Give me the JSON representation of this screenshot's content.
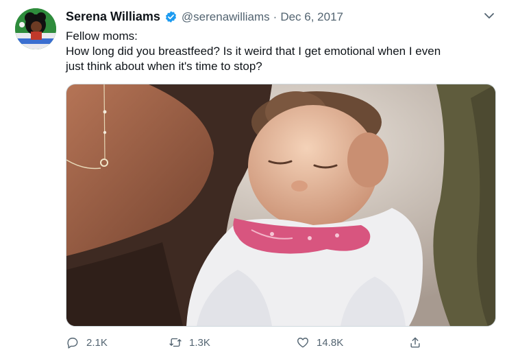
{
  "author": {
    "display_name": "Serena Williams",
    "handle": "@serenawilliams",
    "separator": "·",
    "date": "Dec 6, 2017"
  },
  "tweet": {
    "lines": [
      "Fellow moms:",
      "How long did you breastfeed? Is it weird that I get emotional when I even",
      "just think about when it's time to stop?"
    ]
  },
  "metrics": {
    "replies": "2.1K",
    "retweets": "1.3K",
    "likes": "14.8K"
  },
  "icons": {
    "verified": "verified-badge-icon",
    "more": "chevron-down-icon",
    "reply": "reply-icon",
    "retweet": "retweet-icon",
    "like": "heart-icon",
    "share": "share-icon"
  },
  "colors": {
    "verified_blue": "#1d9bf0",
    "secondary_text": "#536471",
    "bib_pink": "#d8557f"
  }
}
